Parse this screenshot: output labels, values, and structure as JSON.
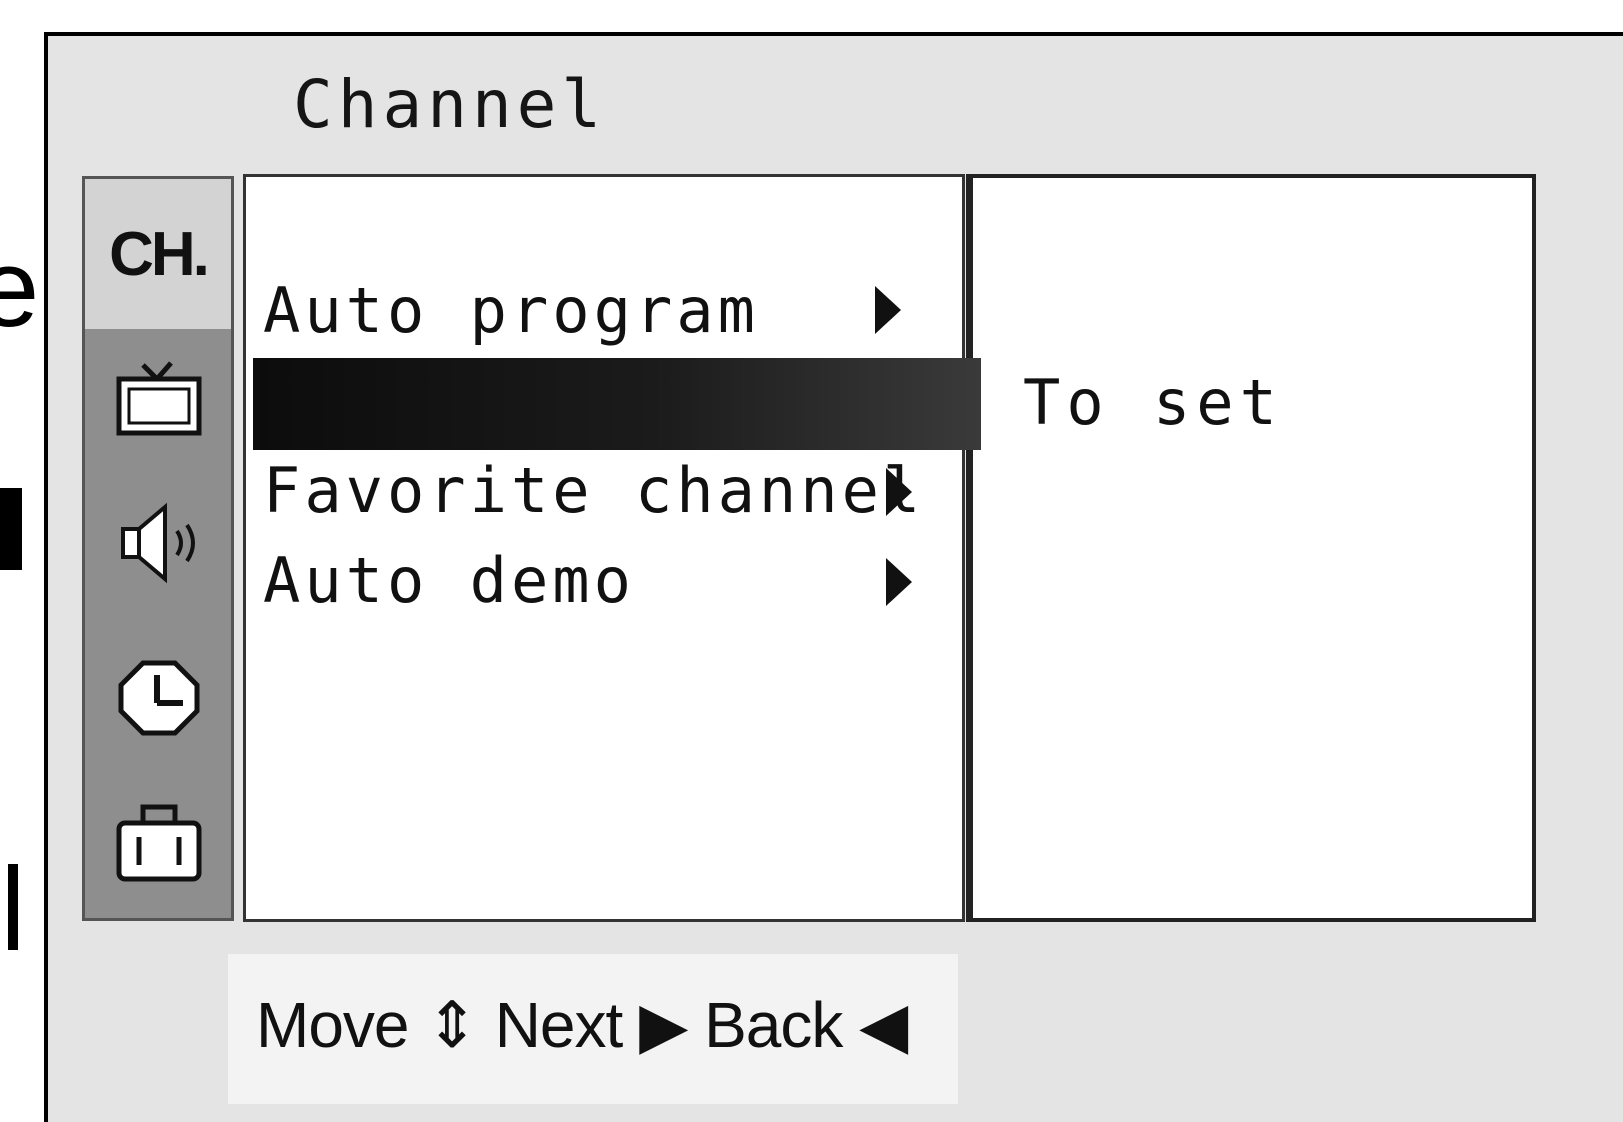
{
  "menu": {
    "title": "Channel",
    "icons": [
      "ch-icon",
      "tv-icon",
      "speaker-icon",
      "clock-icon",
      "toolbox-icon"
    ],
    "ch_label": "CH.",
    "items": [
      {
        "label": "Auto program",
        "selected": false,
        "has_arrow": true
      },
      {
        "label": "",
        "selected": true,
        "has_arrow": false
      },
      {
        "label": "Favorite channel",
        "selected": false,
        "has_arrow": true
      },
      {
        "label": "Auto demo",
        "selected": false,
        "has_arrow": true
      }
    ]
  },
  "submenu": {
    "option": "To set"
  },
  "footer": {
    "hint": "Move ⇕ Next ▶ Back ◀"
  },
  "colors": {
    "osd_background": "#e4e4e4",
    "icon_column": "#8e8e8e",
    "highlight": "#111111"
  }
}
